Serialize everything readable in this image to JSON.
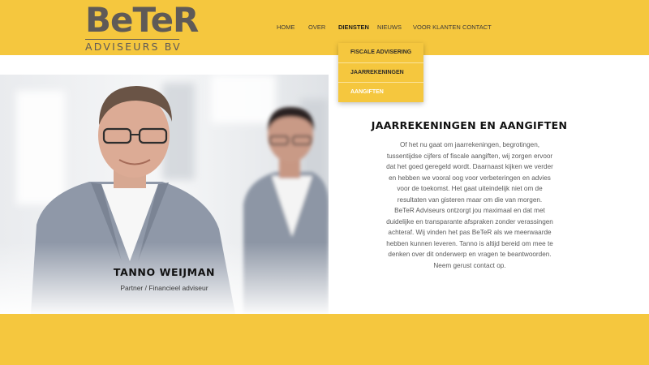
{
  "brand": {
    "logo_text": "BeTeR",
    "logo_subtitle": "ADVISEURS BV"
  },
  "nav": {
    "items": [
      {
        "label": "HOME"
      },
      {
        "label": "OVER"
      },
      {
        "label": "DIENSTEN"
      },
      {
        "label": "NIEUWS"
      },
      {
        "label": "VOOR KLANTEN"
      },
      {
        "label": "CONTACT"
      }
    ],
    "active": "DIENSTEN"
  },
  "dropdown": {
    "items": [
      {
        "label": "FISCALE ADVISERING"
      },
      {
        "label": "JAARREKENINGEN"
      },
      {
        "label": "AANGIFTEN"
      }
    ],
    "active": "AANGIFTEN"
  },
  "person": {
    "name": "TANNO WEIJMAN",
    "role": "Partner / Financieel adviseur"
  },
  "content": {
    "title": "JAARREKENINGEN EN AANGIFTEN",
    "lines": [
      "Of het nu gaat om jaarrekeningen, begrotingen,",
      "tussentijdse cijfers of fiscale aangiften, wij zorgen ervoor",
      "dat het goed geregeld wordt. Daarnaast kijken we verder",
      "en hebben we vooral oog voor verbeteringen en advies",
      "voor de toekomst. Het gaat uiteindelijk niet om de",
      "resultaten van gisteren maar om die van morgen.",
      "BeTeR Adviseurs ontzorgt jou maximaal en dat met",
      "duidelijke en transparante afspraken zonder verassingen",
      "achteraf. Wij vinden het pas BeTeR als we meerwaarde",
      "hebben kunnen leveren. Tanno is altijd bereid om mee te",
      "denken over dit onderwerp en vragen te beantwoorden.",
      "Neem gerust contact op."
    ]
  },
  "colors": {
    "brand_yellow": "#f5c73e",
    "logo_gray": "#5f5a57",
    "active_menu_text": "#ffffff"
  }
}
